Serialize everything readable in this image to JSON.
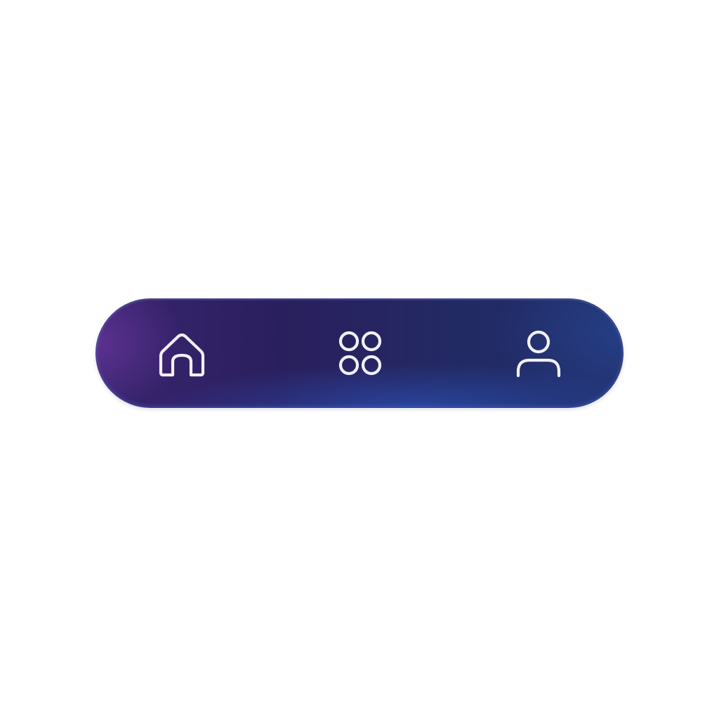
{
  "colors": {
    "background": "#ffffff",
    "bar_gradient_start": "#3a2470",
    "bar_gradient_end": "#22306e",
    "bar_border": "#3a3f8e",
    "icon_stroke": "#f2f0fa"
  },
  "nav": {
    "items": [
      {
        "id": "home",
        "icon": "home-icon"
      },
      {
        "id": "apps",
        "icon": "apps-grid-icon"
      },
      {
        "id": "profile",
        "icon": "user-icon"
      }
    ]
  }
}
